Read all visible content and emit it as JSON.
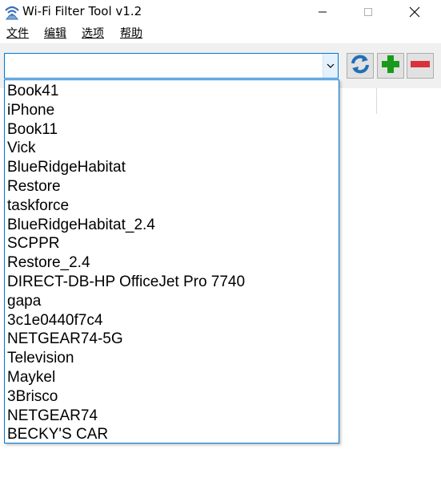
{
  "window": {
    "title": "Wi-Fi Filter Tool v1.2",
    "icon": "wifi-tool-icon"
  },
  "menu": [
    {
      "label": "文件"
    },
    {
      "label": "编辑"
    },
    {
      "label": "选项"
    },
    {
      "label": "帮助"
    }
  ],
  "toolbar": {
    "combo_value": "",
    "refresh_icon": "refresh-icon",
    "add_icon": "plus-icon",
    "remove_icon": "minus-icon"
  },
  "dropdown": {
    "items": [
      "Book41",
      "iPhone",
      "Book11",
      "Vick",
      "BlueRidgeHabitat",
      "Restore",
      "taskforce",
      "BlueRidgeHabitat_2.4",
      "SCPPR",
      "Restore_2.4",
      "DIRECT-DB-HP OfficeJet Pro 7740",
      "gapa",
      "3c1e0440f7c4",
      "NETGEAR74-5G",
      "Television",
      "Maykel",
      "3Brisco",
      "NETGEAR74",
      "BECKY'S CAR"
    ]
  },
  "colors": {
    "accent": "#0078d7",
    "refresh": "#1e6fb8",
    "add": "#1a9a1a",
    "remove": "#d9303a"
  }
}
